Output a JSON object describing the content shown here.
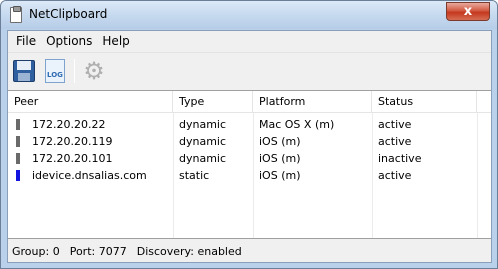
{
  "window": {
    "title": "NetClipboard",
    "close_glyph": "x"
  },
  "menu": [
    "File",
    "Options",
    "Help"
  ],
  "toolbar": [
    {
      "name": "save",
      "icon": "save-icon"
    },
    {
      "name": "log",
      "icon": "log-icon",
      "text": "LOG"
    },
    {
      "name": "settings",
      "icon": "gear-icon",
      "enabled": false
    }
  ],
  "table": {
    "columns": [
      "Peer",
      "Type",
      "Platform",
      "Status"
    ],
    "rows": [
      {
        "marker_color": "#6a6a6a",
        "peer": "172.20.20.22",
        "type": "dynamic",
        "platform": "Mac OS X (m)",
        "status": "active"
      },
      {
        "marker_color": "#6a6a6a",
        "peer": "172.20.20.119",
        "type": "dynamic",
        "platform": "iOS (m)",
        "status": "active"
      },
      {
        "marker_color": "#6a6a6a",
        "peer": "172.20.20.101",
        "type": "dynamic",
        "platform": "iOS (m)",
        "status": "inactive"
      },
      {
        "marker_color": "#1414e0",
        "peer": "idevice.dnsalias.com",
        "type": "static",
        "platform": "iOS (m)",
        "status": "active"
      }
    ]
  },
  "statusbar": {
    "group": "Group: 0",
    "port": "Port: 7077",
    "discovery": "Discovery: enabled"
  }
}
